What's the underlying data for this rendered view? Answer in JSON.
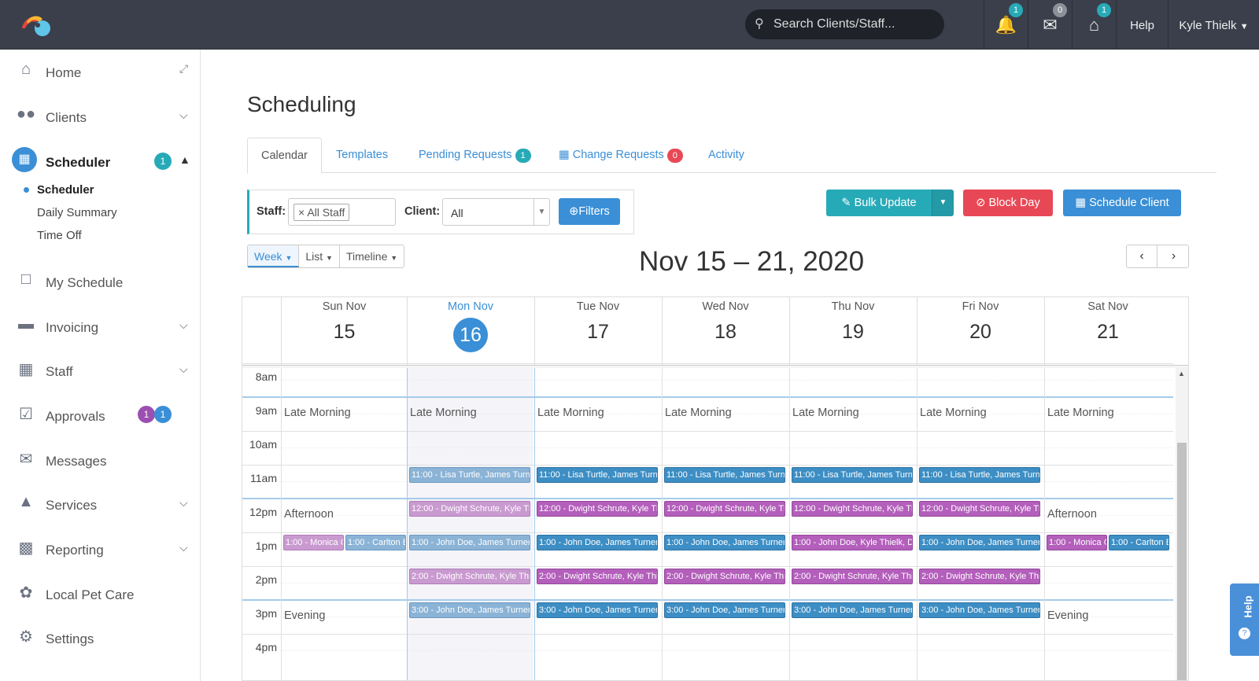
{
  "topbar": {
    "search_placeholder": "Search Clients/Staff...",
    "notifications_count": "1",
    "messages_count": "0",
    "home_count": "1",
    "help_label": "Help",
    "user_name": "Kyle Thielk"
  },
  "sidebar": {
    "home": "Home",
    "clients": "Clients",
    "scheduler": "Scheduler",
    "scheduler_badge": "1",
    "sub_scheduler": "Scheduler",
    "sub_daily": "Daily Summary",
    "sub_timeoff": "Time Off",
    "my_schedule": "My Schedule",
    "invoicing": "Invoicing",
    "staff": "Staff",
    "approvals": "Approvals",
    "approvals_badge_a": "1",
    "approvals_badge_b": "1",
    "messages": "Messages",
    "services": "Services",
    "reporting": "Reporting",
    "local_pet_care": "Local Pet Care",
    "settings": "Settings"
  },
  "main": {
    "title": "Scheduling",
    "tabs": {
      "calendar": "Calendar",
      "templates": "Templates",
      "pending": "Pending Requests",
      "pending_count": "1",
      "change": "Change Requests",
      "change_count": "0",
      "activity": "Activity"
    },
    "filters": {
      "staff_label": "Staff:",
      "staff_value": "All Staff",
      "client_label": "Client:",
      "client_value": "All",
      "filters_button": "Filters"
    },
    "actions": {
      "bulk_update": "Bulk Update",
      "block_day": "Block Day",
      "schedule_client": "Schedule Client"
    },
    "views": {
      "week": "Week",
      "list": "List",
      "timeline": "Timeline"
    },
    "range": "Nov 15 – 21, 2020",
    "days": [
      {
        "name": "Sun Nov",
        "num": "15"
      },
      {
        "name": "Mon Nov",
        "num": "16"
      },
      {
        "name": "Tue Nov",
        "num": "17"
      },
      {
        "name": "Wed Nov",
        "num": "18"
      },
      {
        "name": "Thu Nov",
        "num": "19"
      },
      {
        "name": "Fri Nov",
        "num": "20"
      },
      {
        "name": "Sat Nov",
        "num": "21"
      }
    ],
    "hours": [
      "8am",
      "9am",
      "10am",
      "11am",
      "12pm",
      "1pm",
      "2pm",
      "3pm",
      "4pm"
    ],
    "sections": {
      "late_morning": "Late Morning",
      "afternoon": "Afternoon",
      "evening": "Evening"
    },
    "events": {
      "e11": "11:00 - Lisa Turtle, James Turne",
      "e12": "12:00 - Dwight Schrute, Kyle Th",
      "e1_mon": "1:00 - John Doe, James Turner,",
      "e1_thu": "1:00 - John Doe, Kyle Thielk, Do",
      "e1_fri": "1:00 - John Doe, James Turner, I",
      "e1_monica": "1:00 - Monica G",
      "e1_carlton": "1:00 - Carlton B",
      "e2": "2:00 - Dwight Schrute, Kyle Thie",
      "e3": "3:00 - John Doe, James Turner,"
    }
  },
  "help_tab": "Help"
}
